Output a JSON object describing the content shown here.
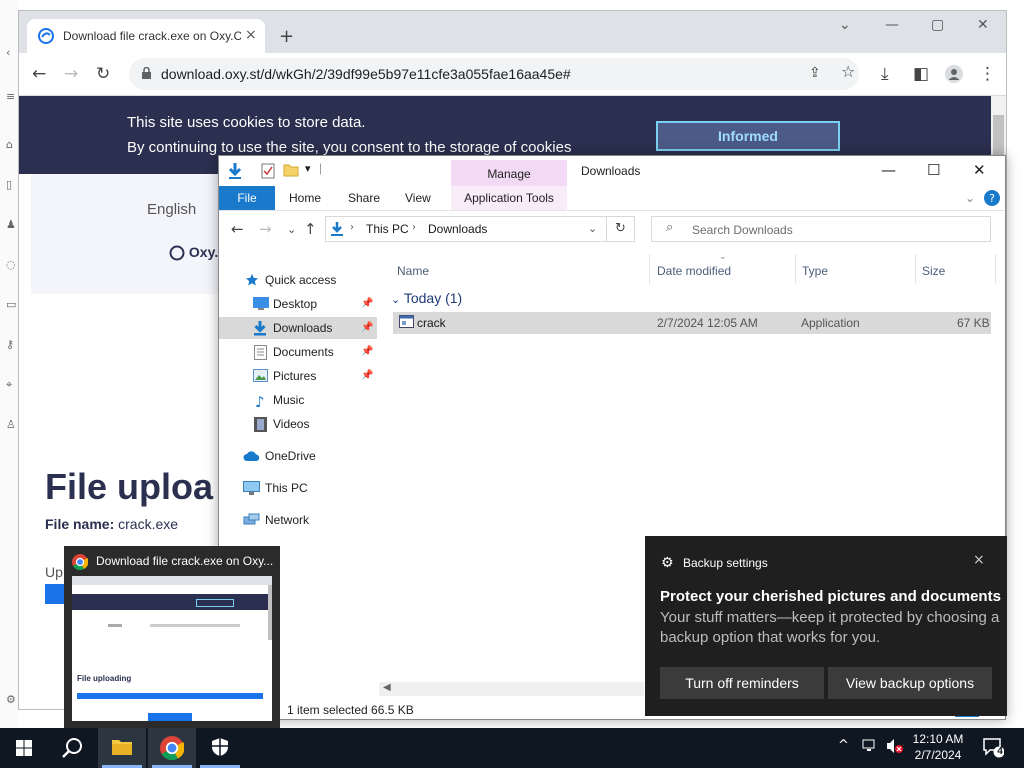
{
  "browser": {
    "tab_title": "Download file crack.exe on Oxy.C",
    "tab_close": "×",
    "new_tab": "+",
    "url": "download.oxy.st/d/wkGh/2/39df99e5b97e11cfe3a055fae16aa45e#"
  },
  "page": {
    "cookie_line1": "This site uses cookies to store data.",
    "cookie_line2": "By continuing to use the site, you consent to the storage of cookies",
    "cookie_button": "Informed",
    "language": "English",
    "brand": "Oxy.C",
    "heading": "File uploa",
    "file_name_label": "File name:",
    "file_name_value": "crack.exe",
    "upload_label": "Up"
  },
  "explorer": {
    "title": "Downloads",
    "manage_tab": "Manage",
    "ribbon": {
      "file": "File",
      "home": "Home",
      "share": "Share",
      "view": "View",
      "app_tools": "Application Tools"
    },
    "breadcrumb": [
      "This PC",
      "Downloads"
    ],
    "search_placeholder": "Search Downloads",
    "nav": {
      "quick_access": "Quick access",
      "desktop": "Desktop",
      "downloads": "Downloads",
      "documents": "Documents",
      "pictures": "Pictures",
      "music": "Music",
      "videos": "Videos",
      "onedrive": "OneDrive",
      "this_pc": "This PC",
      "network": "Network"
    },
    "columns": {
      "name": "Name",
      "date": "Date modified",
      "type": "Type",
      "size": "Size"
    },
    "group": "Today (1)",
    "files": [
      {
        "name": "crack",
        "date": "2/7/2024 12:05 AM",
        "type": "Application",
        "size": "67 KB"
      }
    ],
    "status": "1 item selected  66.5 KB"
  },
  "toast": {
    "app": "Backup settings",
    "title": "Protect your cherished pictures and documents",
    "body": "Your stuff matters—keep it protected by choosing a backup option that works for you.",
    "btn1": "Turn off reminders",
    "btn2": "View backup options",
    "close": "×"
  },
  "thumbnail": {
    "title": "Download file crack.exe on Oxy...",
    "heading": "File uploading"
  },
  "taskbar": {
    "time": "12:10 AM",
    "date": "2/7/2024",
    "notification_count": "4"
  },
  "colors": {
    "cookie_bg": "#2b3050",
    "explorer_accent": "#1979ca",
    "manage_tab": "#f2d9f4",
    "toast_bg": "#1f1f1f",
    "taskbar_bg": "#0e1722"
  }
}
